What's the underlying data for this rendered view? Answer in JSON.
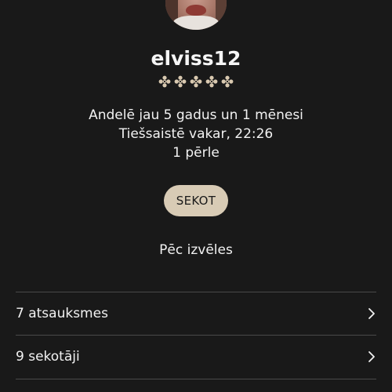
{
  "profile": {
    "username": "elviss12",
    "rating_stars": 5,
    "rating_icon": "diamond-flower-icon",
    "member_since": "Andelē jau 5 gadus un 1 mēnesi",
    "last_online": "Tiešsaistē vakar, 22:26",
    "pearls": "1 pērle",
    "follow_button_label": "SEKOT",
    "description": "Pēc izvēles"
  },
  "list": {
    "items": [
      {
        "label": "7 atsauksmes",
        "icon": "chevron-right-icon"
      },
      {
        "label": "9 sekotāji",
        "icon": "chevron-right-icon"
      }
    ]
  },
  "colors": {
    "background": "#191919",
    "text": "#f2f2f2",
    "accent_button": "#d8cbb5",
    "star": "#d9c9b0",
    "divider": "#4a4a4a"
  }
}
